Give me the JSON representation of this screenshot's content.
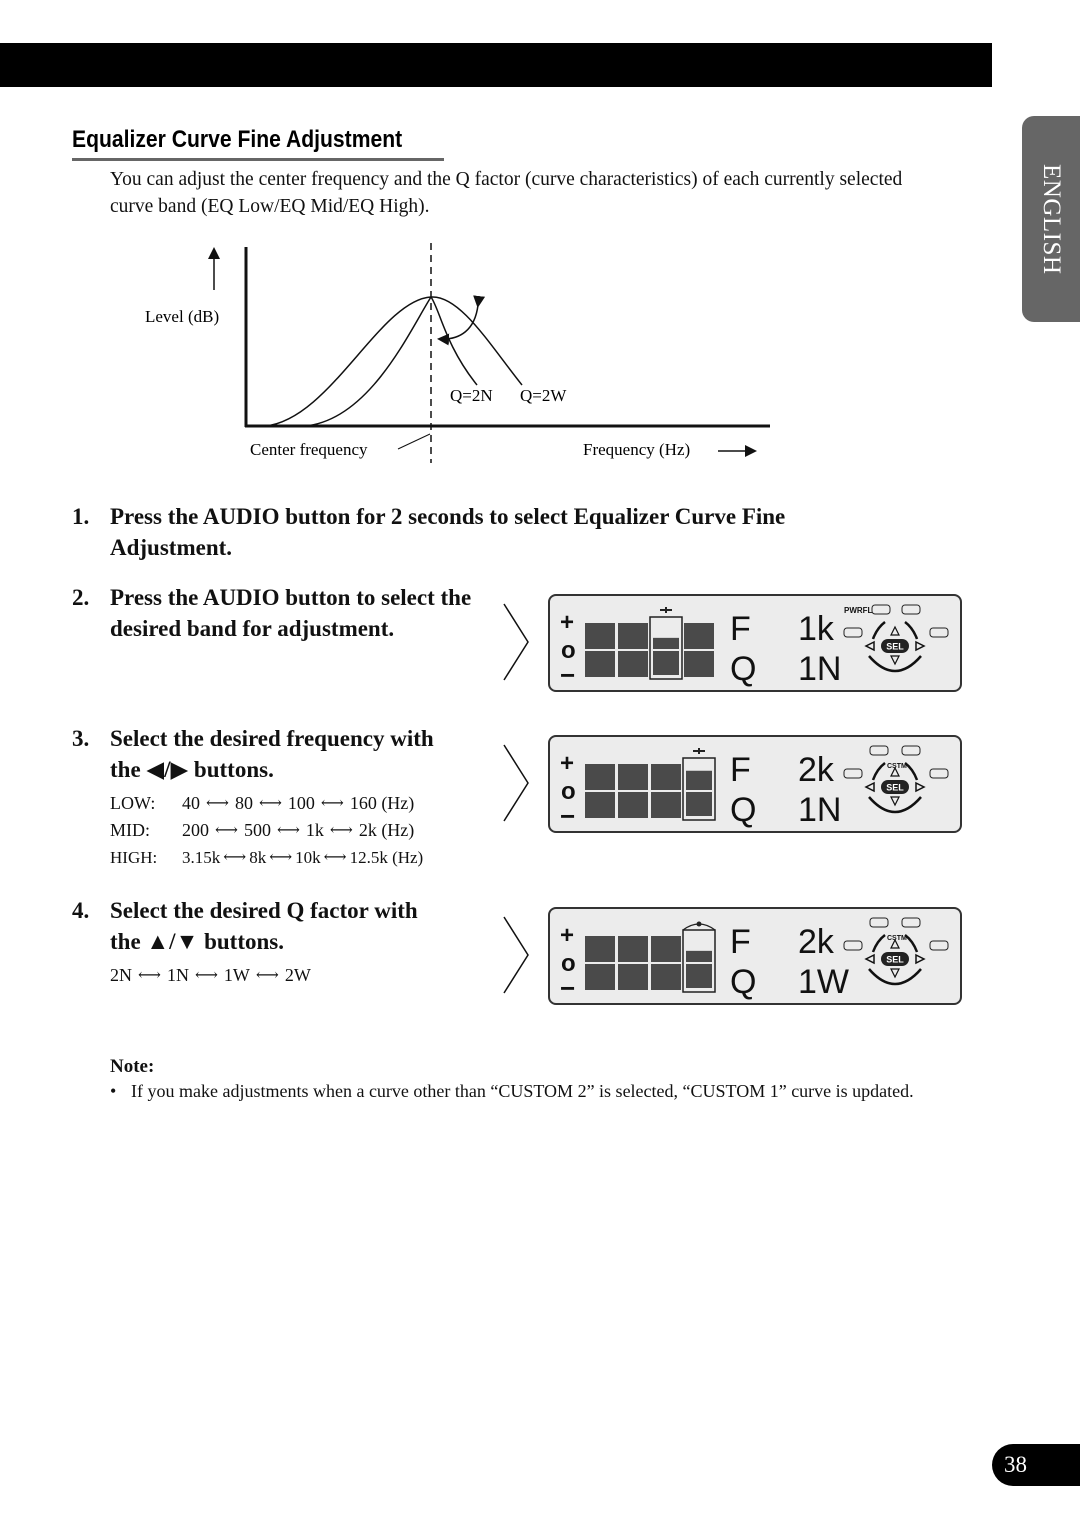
{
  "side_tab": {
    "label": "ENGLISH"
  },
  "section": {
    "title": "Equalizer Curve Fine Adjustment",
    "intro": "You can adjust the center frequency and the Q factor (curve characteristics) of each currently selected curve band (EQ Low/EQ Mid/EQ High)."
  },
  "diagram": {
    "y_label": "Level (dB)",
    "x_label": "Frequency (Hz)",
    "center_label": "Center frequency",
    "curve_labels": [
      "Q=2N",
      "Q=2W"
    ]
  },
  "steps": [
    {
      "number": "1.",
      "text": "Press the AUDIO button for 2 seconds to select Equalizer Curve Fine Adjustment."
    },
    {
      "number": "2.",
      "text": "Press the AUDIO button to select the desired band for adjustment."
    },
    {
      "number": "3.",
      "text_a": "Select the desired frequency with",
      "text_b": "the ◀/▶ buttons.",
      "frequency_options": [
        {
          "band": "LOW:",
          "values": [
            "40",
            "80",
            "100",
            "160 (Hz)"
          ]
        },
        {
          "band": "MID:",
          "values": [
            "200",
            "500",
            "1k",
            "2k (Hz)"
          ]
        },
        {
          "band": "HIGH:",
          "values": [
            "3.15k",
            "8k",
            "10k",
            "12.5k (Hz)"
          ]
        }
      ]
    },
    {
      "number": "4.",
      "text_a": "Select the desired Q factor with",
      "text_b": "the ▲/▼ buttons.",
      "q_options": [
        "2N",
        "1N",
        "1W",
        "2W"
      ]
    }
  ],
  "displays": [
    {
      "f_label": "F",
      "f_value": "1k",
      "q_label": "Q",
      "q_value": "1N",
      "indicator": "PWRFL",
      "selected_band": 3,
      "level_fraction": 0.45,
      "sel_label": "SEL"
    },
    {
      "f_label": "F",
      "f_value": "2k",
      "q_label": "Q",
      "q_value": "1N",
      "indicator": "CSTM",
      "selected_band": 4,
      "level_fraction": 0.75,
      "sel_label": "SEL"
    },
    {
      "f_label": "F",
      "f_value": "2k",
      "q_label": "Q",
      "q_value": "1W",
      "indicator": "CSTM",
      "selected_band": 4,
      "level_fraction": 0.45,
      "sel_label": "SEL"
    }
  ],
  "lcd_scale": {
    "plus": "+",
    "zero": "o",
    "minus": "−"
  },
  "note": {
    "title": "Note:",
    "bullet": "•",
    "items": [
      "If you make adjustments when a curve other than “CUSTOM 2” is selected, “CUSTOM 1” curve is updated."
    ]
  },
  "page_number": "38"
}
